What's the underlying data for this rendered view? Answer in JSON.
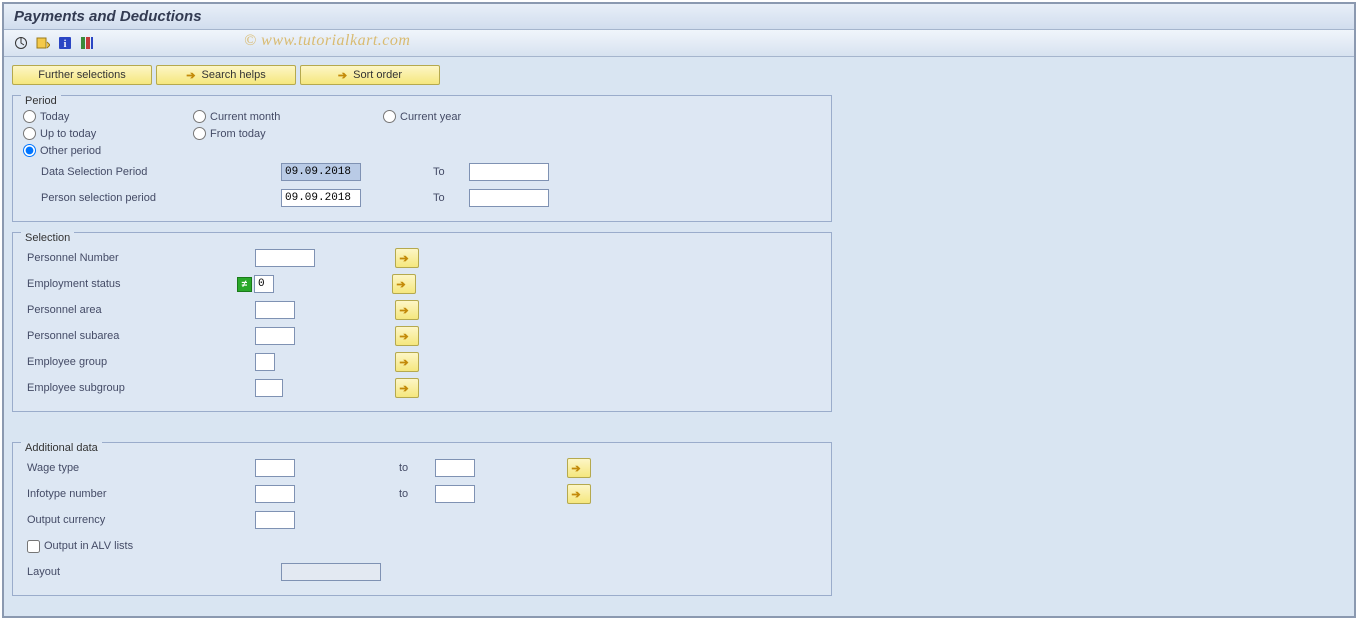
{
  "title": "Payments and Deductions",
  "watermark": "© www.tutorialkart.com",
  "topButtons": {
    "further": "Further selections",
    "searchHelps": "Search helps",
    "sortOrder": "Sort order"
  },
  "period": {
    "title": "Period",
    "today": "Today",
    "currentMonth": "Current month",
    "currentYear": "Current year",
    "upToToday": "Up to today",
    "fromToday": "From today",
    "otherPeriod": "Other period",
    "dataSelPeriod": "Data Selection Period",
    "personSelPeriod": "Person selection period",
    "dataFrom": "09.09.2018",
    "dataTo": "",
    "personFrom": "09.09.2018",
    "personTo": "",
    "to": "To"
  },
  "selection": {
    "title": "Selection",
    "personnelNumber": "Personnel Number",
    "employmentStatus": "Employment status",
    "employmentStatusVal": "0",
    "personnelArea": "Personnel area",
    "personnelSubarea": "Personnel subarea",
    "employeeGroup": "Employee group",
    "employeeSubgroup": "Employee subgroup"
  },
  "additional": {
    "title": "Additional data",
    "wageType": "Wage type",
    "infotypeNumber": "Infotype number",
    "outputCurrency": "Output currency",
    "outputAlv": "Output in ALV lists",
    "layout": "Layout",
    "to": "to"
  }
}
